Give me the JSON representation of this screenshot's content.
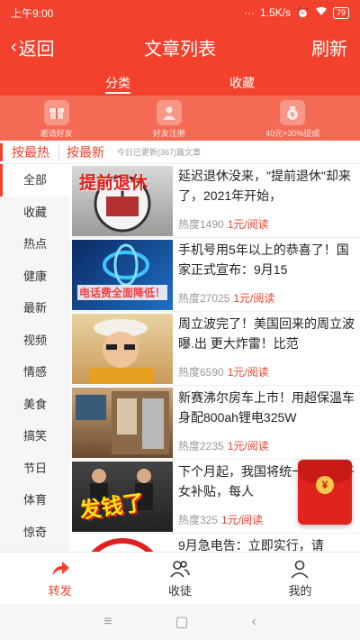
{
  "status_bar": {
    "time": "上午9:00",
    "network_speed": "1.5K/s",
    "battery": "79"
  },
  "nav": {
    "back_label": "返回",
    "title": "文章列表",
    "refresh_label": "刷新"
  },
  "tabs": [
    {
      "label": "分类",
      "active": true
    },
    {
      "label": "收藏",
      "active": false
    }
  ],
  "banner": {
    "items": [
      {
        "label": "邀请好友",
        "icon": "gift-icon"
      },
      {
        "label": "好友注册",
        "icon": "user-card-icon"
      },
      {
        "label": "40元+30%提成",
        "icon": "money-bag-icon"
      }
    ]
  },
  "sort": {
    "hot_label": "按最热",
    "new_label": "按最新",
    "update_note": "今日已更新(367)篇文章"
  },
  "categories": [
    "全部",
    "收藏",
    "热点",
    "健康",
    "最新",
    "视频",
    "情感",
    "美食",
    "搞笑",
    "节日",
    "体育",
    "惊奇"
  ],
  "articles": [
    {
      "title": "延迟退休没来，\"提前退休\"却来了，2021年开始，",
      "heat_label": "热度1490",
      "reward": "1元/阅读",
      "thumb_text": "提前退休"
    },
    {
      "title": "手机号用5年以上的恭喜了！国家正式宣布：9月15",
      "heat_label": "热度27025",
      "reward": "1元/阅读",
      "thumb_text": "电话费全面降低！"
    },
    {
      "title": "周立波完了！美国回来的周立波曝.出 更大炸雷！比范",
      "heat_label": "热度6590",
      "reward": "1元/阅读",
      "thumb_text": ""
    },
    {
      "title": "新赛沸尔房车上市！用超保温车身配800ah锂电325W",
      "heat_label": "热度2235",
      "reward": "1元/阅读",
      "thumb_text": ""
    },
    {
      "title": "下个月起，我国将统一对独生子女补贴，每人",
      "heat_label": "热度325",
      "reward": "1元/阅读",
      "thumb_text": "发钱了"
    },
    {
      "title": "9月急电告：立即实行，请",
      "heat_label": "",
      "reward": "",
      "thumb_text": ""
    }
  ],
  "red_packet": {
    "symbol": "¥"
  },
  "bottom_nav": [
    {
      "label": "转发",
      "icon": "share-arrow-icon",
      "active": true
    },
    {
      "label": "收徒",
      "icon": "users-icon",
      "active": false
    },
    {
      "label": "我的",
      "icon": "person-icon",
      "active": false
    }
  ],
  "system_nav": {
    "menu": "≡",
    "home": "▢",
    "back": "‹"
  },
  "colors": {
    "accent": "#f2412c",
    "banner": "#f56a55",
    "sidebar_bg": "#f6f6f6"
  }
}
